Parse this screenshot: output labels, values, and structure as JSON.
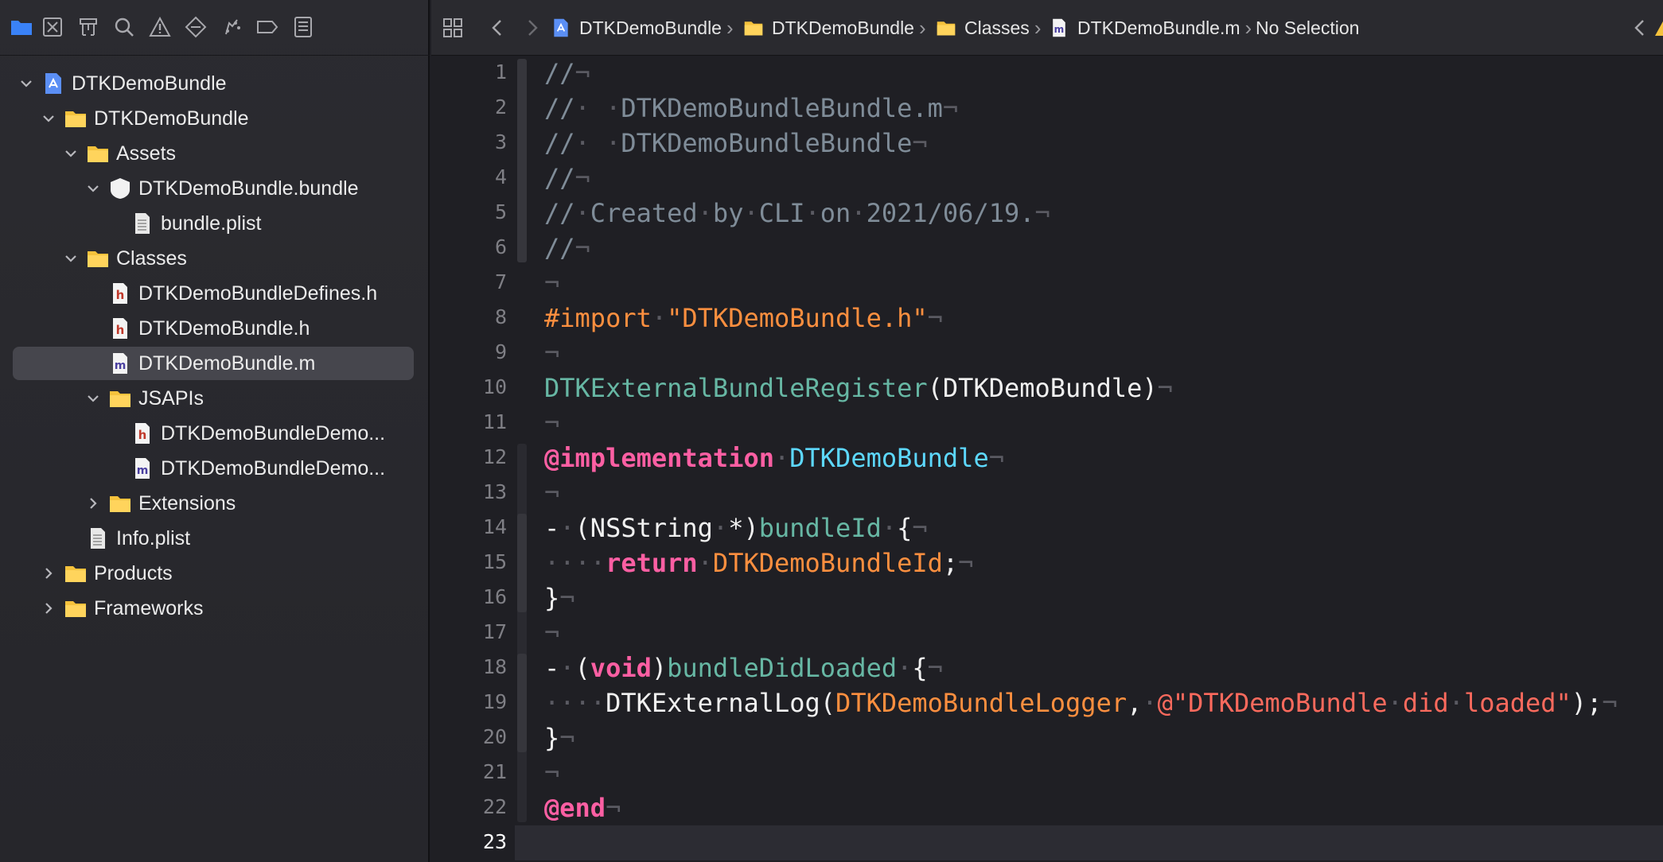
{
  "navigator": {
    "toolbar_icons": [
      "folder-icon",
      "source-control-icon",
      "symbol-icon",
      "find-icon",
      "issue-icon",
      "test-icon",
      "debug-icon",
      "breakpoint-icon",
      "report-icon"
    ],
    "tree": [
      {
        "label": "DTKDemoBundle",
        "icon": "xcode-project-icon",
        "depth": 0,
        "expanded": true
      },
      {
        "label": "DTKDemoBundle",
        "icon": "folder-icon",
        "depth": 1,
        "expanded": true
      },
      {
        "label": "Assets",
        "icon": "folder-icon",
        "depth": 2,
        "expanded": true
      },
      {
        "label": "DTKDemoBundle.bundle",
        "icon": "bundle-icon",
        "depth": 3,
        "expanded": true
      },
      {
        "label": "bundle.plist",
        "icon": "plist-icon",
        "depth": 4
      },
      {
        "label": "Classes",
        "icon": "folder-icon",
        "depth": 2,
        "expanded": true
      },
      {
        "label": "DTKDemoBundleDefines.h",
        "icon": "header-file-icon",
        "depth": 3
      },
      {
        "label": "DTKDemoBundle.h",
        "icon": "header-file-icon",
        "depth": 3
      },
      {
        "label": "DTKDemoBundle.m",
        "icon": "implementation-file-icon",
        "depth": 3,
        "selected": true
      },
      {
        "label": "JSAPIs",
        "icon": "folder-icon",
        "depth": 3,
        "expanded": true
      },
      {
        "label": "DTKDemoBundleDemo...",
        "icon": "header-file-icon",
        "depth": 4
      },
      {
        "label": "DTKDemoBundleDemo...",
        "icon": "implementation-file-icon",
        "depth": 4
      },
      {
        "label": "Extensions",
        "icon": "folder-icon",
        "depth": 3,
        "expanded": false
      },
      {
        "label": "Info.plist",
        "icon": "plist-icon",
        "depth": 2
      },
      {
        "label": "Products",
        "icon": "folder-icon",
        "depth": 1,
        "expanded": false
      },
      {
        "label": "Frameworks",
        "icon": "folder-icon",
        "depth": 1,
        "expanded": false
      }
    ]
  },
  "jumpbar": {
    "crumbs": [
      {
        "label": "DTKDemoBundle",
        "icon": "xcode-project-icon"
      },
      {
        "label": "DTKDemoBundle",
        "icon": "folder-icon"
      },
      {
        "label": "Classes",
        "icon": "folder-icon"
      },
      {
        "label": "DTKDemoBundle.m",
        "icon": "implementation-file-icon"
      },
      {
        "label": "No Selection",
        "icon": ""
      }
    ]
  },
  "editor": {
    "current_line": 23,
    "lines": [
      [
        [
          "//",
          "comment"
        ],
        [
          "¬",
          "inv"
        ]
      ],
      [
        [
          "//",
          "comment"
        ],
        [
          "·",
          "inv"
        ],
        [
          " ",
          "plain"
        ],
        [
          "·",
          "inv"
        ],
        [
          "DTKDemoBundleBundle.m",
          "comment"
        ],
        [
          "¬",
          "inv"
        ]
      ],
      [
        [
          "//",
          "comment"
        ],
        [
          "·",
          "inv"
        ],
        [
          " ",
          "plain"
        ],
        [
          "·",
          "inv"
        ],
        [
          "DTKDemoBundleBundle",
          "comment"
        ],
        [
          "¬",
          "inv"
        ]
      ],
      [
        [
          "//",
          "comment"
        ],
        [
          "¬",
          "inv"
        ]
      ],
      [
        [
          "//",
          "comment"
        ],
        [
          "·",
          "inv"
        ],
        [
          "Created",
          "comment"
        ],
        [
          "·",
          "inv"
        ],
        [
          "by",
          "comment"
        ],
        [
          "·",
          "inv"
        ],
        [
          "CLI",
          "comment"
        ],
        [
          "·",
          "inv"
        ],
        [
          "on",
          "comment"
        ],
        [
          "·",
          "inv"
        ],
        [
          "2021/06/19.",
          "comment"
        ],
        [
          "¬",
          "inv"
        ]
      ],
      [
        [
          "//",
          "comment"
        ],
        [
          "¬",
          "inv"
        ]
      ],
      [
        [
          "¬",
          "inv"
        ]
      ],
      [
        [
          "#import",
          "pre"
        ],
        [
          "·",
          "inv"
        ],
        [
          "\"DTKDemoBundle.h\"",
          "pre"
        ],
        [
          "¬",
          "inv"
        ]
      ],
      [
        [
          "¬",
          "inv"
        ]
      ],
      [
        [
          "DTKExternalBundleRegister",
          "fn"
        ],
        [
          "(DTKDemoBundle)",
          "plain"
        ],
        [
          "¬",
          "inv"
        ]
      ],
      [
        [
          "¬",
          "inv"
        ]
      ],
      [
        [
          "@implementation",
          "kw"
        ],
        [
          "·",
          "inv"
        ],
        [
          "DTKDemoBundle",
          "type"
        ],
        [
          "¬",
          "inv"
        ]
      ],
      [
        [
          "¬",
          "inv"
        ]
      ],
      [
        [
          "-",
          "plain"
        ],
        [
          "·",
          "inv"
        ],
        [
          "(NSString",
          "plain"
        ],
        [
          "·",
          "inv"
        ],
        [
          "*)",
          "plain"
        ],
        [
          "bundleId",
          "method"
        ],
        [
          "·",
          "inv"
        ],
        [
          "{",
          "plain"
        ],
        [
          "¬",
          "inv"
        ]
      ],
      [
        [
          "····",
          "inv"
        ],
        [
          "return",
          "kw"
        ],
        [
          "·",
          "inv"
        ],
        [
          "DTKDemoBundleId",
          "macro"
        ],
        [
          ";",
          "plain"
        ],
        [
          "¬",
          "inv"
        ]
      ],
      [
        [
          "}",
          "plain"
        ],
        [
          "¬",
          "inv"
        ]
      ],
      [
        [
          "¬",
          "inv"
        ]
      ],
      [
        [
          "-",
          "plain"
        ],
        [
          "·",
          "inv"
        ],
        [
          "(",
          "plain"
        ],
        [
          "void",
          "kw"
        ],
        [
          ")",
          "plain"
        ],
        [
          "bundleDidLoaded",
          "method"
        ],
        [
          "·",
          "inv"
        ],
        [
          "{",
          "plain"
        ],
        [
          "¬",
          "inv"
        ]
      ],
      [
        [
          "····",
          "inv"
        ],
        [
          "DTKExternalLog(",
          "plain"
        ],
        [
          "DTKDemoBundleLogger",
          "macro"
        ],
        [
          ",",
          "plain"
        ],
        [
          "·",
          "inv"
        ],
        [
          "@\"DTKDemoBundle",
          "str"
        ],
        [
          "·",
          "inv"
        ],
        [
          "did",
          "str"
        ],
        [
          "·",
          "inv"
        ],
        [
          "loaded\"",
          "str"
        ],
        [
          ");",
          "plain"
        ],
        [
          "¬",
          "inv"
        ]
      ],
      [
        [
          "}",
          "plain"
        ],
        [
          "¬",
          "inv"
        ]
      ],
      [
        [
          "¬",
          "inv"
        ]
      ],
      [
        [
          "@end",
          "kw"
        ],
        [
          "¬",
          "inv"
        ]
      ],
      []
    ]
  },
  "colors": {
    "comment": "#7f8c98",
    "keyword": "#fc5fa3",
    "preprocessor": "#fd8f3f",
    "type": "#5dd8ff",
    "method": "#67b7a4",
    "folder": "#f5c23c",
    "accent": "#3a82f7"
  }
}
